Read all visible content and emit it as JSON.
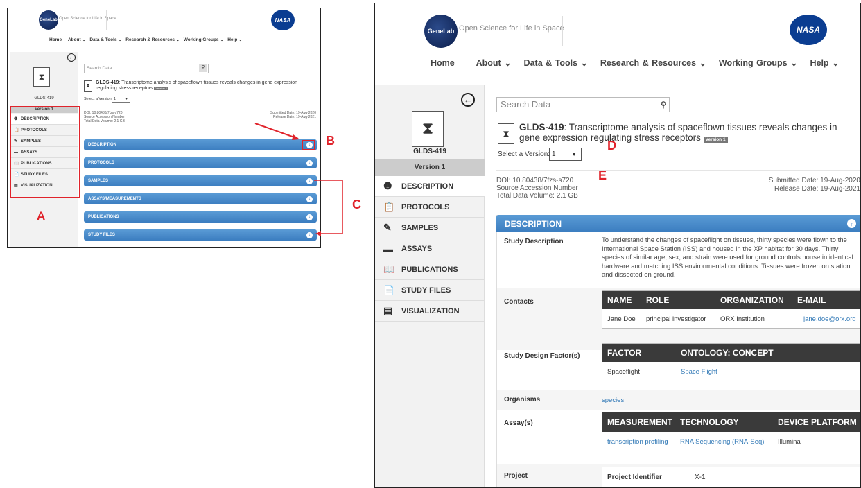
{
  "site": {
    "logo_text": "GeneLab",
    "tagline": "Open Science for Life in Space",
    "nasa": "NASA"
  },
  "nav": [
    "Home",
    "About ⌄",
    "Data & Tools ⌄",
    "Research & Resources ⌄",
    "Working Groups ⌄",
    "Help ⌄"
  ],
  "search": {
    "placeholder": "Search Data",
    "clear": "×"
  },
  "dataset": {
    "id": "GLDS-419",
    "title": ": Transcriptome analysis of spaceflown tissues reveals changes in gene expression regulating stress receptors",
    "version_badge": "Version 1",
    "version_label": "Select a Version:",
    "version_value": "1",
    "doi": "DOI: 10.80438/7fzs-s720",
    "source_accession": "Source Accession Number",
    "total_volume": "Total Data Volume: 2.1 GB",
    "submitted": "Submitted Date: 19-Aug-2020",
    "released": "Release Date: 19-Aug-2021"
  },
  "sidebar": {
    "id": "GLDS-419",
    "version": "Version 1",
    "items": [
      "DESCRIPTION",
      "PROTOCOLS",
      "SAMPLES",
      "ASSAYS",
      "PUBLICATIONS",
      "STUDY FILES",
      "VISUALIZATION"
    ]
  },
  "sections": [
    "DESCRIPTION",
    "PROTOCOLS",
    "SAMPLES",
    "ASSAYS/MEASUREMENTS",
    "PUBLICATIONS",
    "STUDY FILES"
  ],
  "description": {
    "header": "DESCRIPTION",
    "study_description_label": "Study Description",
    "study_description": "To understand the changes of spaceflight on tissues, thirty species were flown to the International Space Station (ISS) and housed in the XP habitat for 30 days. Thirty species of similar age, sex, and strain were used for ground controls house in identical hardware and matching ISS environmental conditions. Tissues were frozen on station and dissected on ground.",
    "contacts_label": "Contacts",
    "contacts_headers": [
      "NAME",
      "ROLE",
      "ORGANIZATION",
      "E-MAIL"
    ],
    "contacts_row": [
      "Jane Doe",
      "principal investigator",
      "ORX Institution",
      "jane.doe@orx.org"
    ],
    "factor_label": "Study Design Factor(s)",
    "factor_headers": [
      "FACTOR",
      "ONTOLOGY: CONCEPT"
    ],
    "factor_row": [
      "Spaceflight",
      "Space Flight"
    ],
    "organisms_label": "Organisms",
    "organisms_value": "species",
    "assay_label": "Assay(s)",
    "assay_headers": [
      "MEASUREMENT",
      "TECHNOLOGY",
      "DEVICE PLATFORM"
    ],
    "assay_row": [
      "transcription profiling",
      "RNA Sequencing (RNA-Seq)",
      "Illumina"
    ],
    "project_label": "Project",
    "project_id_label": "Project Identifier",
    "project_id": "X-1"
  },
  "annotations": {
    "a": "A",
    "b": "B",
    "c": "C",
    "d": "D",
    "e": "E"
  },
  "colors": {
    "accent": "#3b7dc0",
    "annotation": "#e0232b",
    "table_header": "#3a3a3a"
  }
}
